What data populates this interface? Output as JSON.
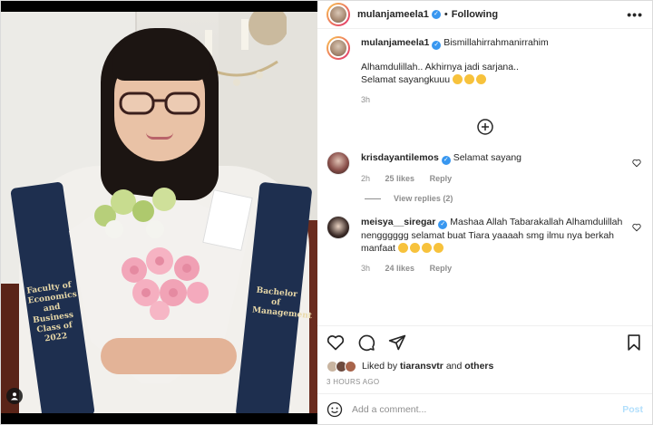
{
  "post": {
    "author": "mulanjameela1",
    "follow_status": "Following",
    "separator": "•",
    "more_label": "•••",
    "caption_first": "Bismillahirrahmanirrahim",
    "caption_line2": "Alhamdulillah.. Akhirnya jadi sarjana..",
    "caption_line3": "Selamat sayangkuuu",
    "caption_time": "3h"
  },
  "photo": {
    "stole_left_text": "Faculty of Economics and Business Class of 2022",
    "stole_right_text": "Bachelor of Management"
  },
  "comments": [
    {
      "user": "krisdayantilemos",
      "text": "Selamat sayang",
      "time": "2h",
      "likes": "25 likes",
      "reply": "Reply",
      "view_replies": "View replies (2)"
    },
    {
      "user": "meisya__siregar",
      "text": "Mashaa Allah Tabarakallah Alhamdulillah nengggggg selamat buat Tiara yaaaah smg ilmu nya berkah manfaat",
      "time": "3h",
      "likes": "24 likes",
      "reply": "Reply"
    }
  ],
  "liked_by": {
    "prefix": "Liked by",
    "user": "tiaransvtr",
    "and": "and",
    "others": "others"
  },
  "time_ago": "3 HOURS AGO",
  "add_comment": {
    "placeholder": "Add a comment...",
    "post_label": "Post"
  },
  "icons": [
    "heart-icon",
    "comment-icon",
    "share-icon",
    "bookmark-icon",
    "emoji-icon",
    "add-circle-icon",
    "more-icon",
    "verified-icon",
    "user-tag-icon"
  ],
  "colors": {
    "verified": "#3897f0",
    "muted": "#8e8e8e",
    "post_disabled": "#b2dffc",
    "text": "#262626"
  }
}
